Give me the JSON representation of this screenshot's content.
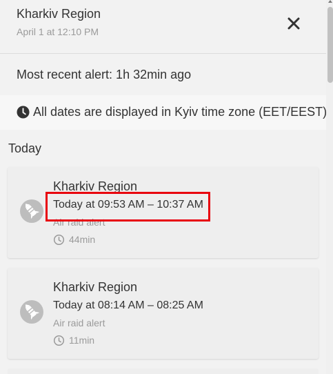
{
  "header": {
    "title": "Kharkiv Region",
    "subtitle": "April 1 at 12:10 PM",
    "close_icon": "close-icon"
  },
  "recent_alert": {
    "text": "Most recent alert: 1h 32min ago"
  },
  "timezone_note": {
    "icon": "clock-filled-icon",
    "text": "All dates are displayed in Kyiv time zone (EET/EEST)."
  },
  "section": {
    "label": "Today"
  },
  "alerts": [
    {
      "region": "Kharkiv Region",
      "time": "Today at 09:53 AM – 10:37 AM",
      "type": "Air raid alert",
      "duration": "44min",
      "icon": "rocket-icon",
      "highlighted": true
    },
    {
      "region": "Kharkiv Region",
      "time": "Today at 08:14 AM – 08:25 AM",
      "type": "Air raid alert",
      "duration": "11min",
      "icon": "rocket-icon",
      "highlighted": false
    }
  ],
  "colors": {
    "background": "#f2f2f2",
    "card": "#eeeeee",
    "highlight": "#e8000d",
    "muted_text": "#9a9a9a"
  }
}
